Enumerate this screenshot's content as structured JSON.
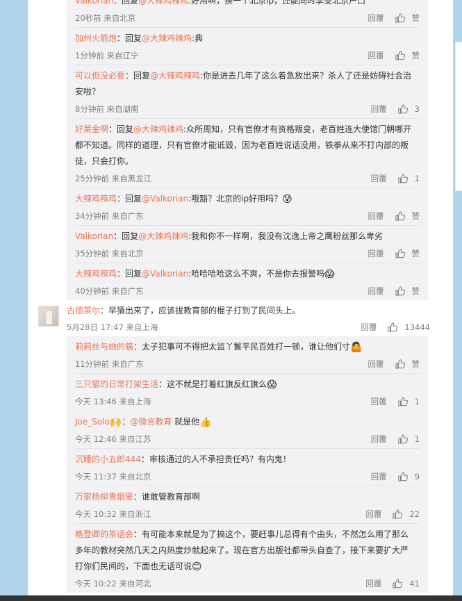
{
  "replies_top": [
    {
      "user": "Valkorian",
      "prefix": "：回复",
      "at": "@大辣鸡辣鸡",
      "text": ":好用啊，换一个北京ip，还能同时享受北京户口",
      "emoji": "",
      "time": "20秒前 来自北京",
      "reply_label": "回覆",
      "likes": "赞"
    },
    {
      "user": "加州火箭炮",
      "prefix": "：回复",
      "at": "@大辣鸡辣鸡",
      "text": ":典",
      "emoji": "",
      "time": "1分钟前 来自辽宁",
      "reply_label": "回覆",
      "likes": "赞"
    },
    {
      "user": "可以但没必要",
      "prefix": "：回复",
      "at": "@大辣鸡辣鸡",
      "text": ":你是进去几年了这么着急放出来？杀人了还是妨碍社会治安啦？",
      "emoji": "",
      "time": "8分钟前 来自湖南",
      "reply_label": "回覆",
      "likes": "3"
    },
    {
      "user": "好莱金啊",
      "prefix": "：回复",
      "at": "@大辣鸡辣鸡",
      "text": ":众所周知，只有官僚才有资格叛变，老百姓连大使馆门朝哪开都不知道。同样的道理，只有官僚才能诋毁，因为老百姓说话没用，铁拳从来不打内部的叛徒，只会打你。",
      "emoji": "",
      "time": "25分钟前 来自黑龙江",
      "reply_label": "回覆",
      "likes": "1"
    },
    {
      "user": "大辣鸡辣鸡",
      "prefix": "：回复",
      "at": "@Valkorian",
      "text": ":哦豁？北京的ip好用吗？",
      "emoji": "😰",
      "time": "34分钟前 来自广东",
      "reply_label": "回覆",
      "likes": "赞"
    },
    {
      "user": "Valkorian",
      "prefix": "：回复",
      "at": "@大辣鸡辣鸡",
      "text": ":我和你不一样啊，我没有沈逸上帝之鹰粉丝那么卑劣",
      "emoji": "",
      "time": "35分钟前 来自北京",
      "reply_label": "回覆",
      "likes": "赞"
    },
    {
      "user": "大辣鸡辣鸡",
      "prefix": "：回复",
      "at": "@Valkorian",
      "text": ":哈哈哈哈这么不爽，不是你去报警吗",
      "emoji": "😱",
      "time": "40分钟前 来自广东",
      "reply_label": "回覆",
      "likes": "赞"
    }
  ],
  "main_comment": {
    "user": "古德莱尔",
    "text": "：早猜出来了，应该拔教育部的棍子打到了民间头上。",
    "time": "5月28日 17:47 来自上海",
    "reply_label": "回覆",
    "likes": "13444"
  },
  "replies_bottom": [
    {
      "user": "莉莉丝与她的猫",
      "prefix": "：",
      "at": "",
      "text": "太子犯事可不得把太监丫鬟平民百姓打一顿，谁让他们寸",
      "emoji": "🤷",
      "time": "11分钟前 来自广东",
      "reply_label": "回覆",
      "likes": "赞"
    },
    {
      "user": "三只猫的日常打架生活",
      "prefix": "：",
      "at": "",
      "text": "这不就是打着红旗反红旗么",
      "emoji": "😱",
      "time": "今天 13:46 来自上海",
      "reply_label": "回覆",
      "likes": "1"
    },
    {
      "user": "Joe_Solo",
      "prefix": "",
      "at": "",
      "badge": "🙌",
      "text2_at": "@微言教育",
      "text": " 就是他",
      "emoji": "👍",
      "time": "今天 12:46 来自江苏",
      "reply_label": "回覆",
      "likes": "1"
    },
    {
      "user": "沉睡的小五郎444",
      "prefix": "：",
      "at": "",
      "text": "审核通过的人不承担责任吗？有内鬼！",
      "emoji": "",
      "time": "今天 11:37 来自北京",
      "reply_label": "回覆",
      "likes": "9"
    },
    {
      "user": "万家杨柳青烟里",
      "prefix": "：",
      "at": "",
      "text": "谁敢管教育部啊",
      "emoji": "",
      "time": "今天 10:32 来自浙江",
      "reply_label": "回覆",
      "likes": "22"
    },
    {
      "user": "格登卿的茶话会",
      "prefix": "：",
      "at": "",
      "text": "有可能本来就是为了搞这个，要赶事儿总得有个由头，不然怎么用了那么多年的教材突然几天之内热度炒就起来了。现在官方出版社都带头自查了，接下来要扩大严打你们民间的，下面也无话可说",
      "emoji": "😊",
      "time": "今天 10:22 来自河北",
      "reply_label": "回覆",
      "likes": "41"
    }
  ],
  "colors": {
    "username": "#eb7350",
    "meta": "#808080",
    "reply_bg": "#f2f2f5",
    "page_bg": "#b0d4ea"
  }
}
